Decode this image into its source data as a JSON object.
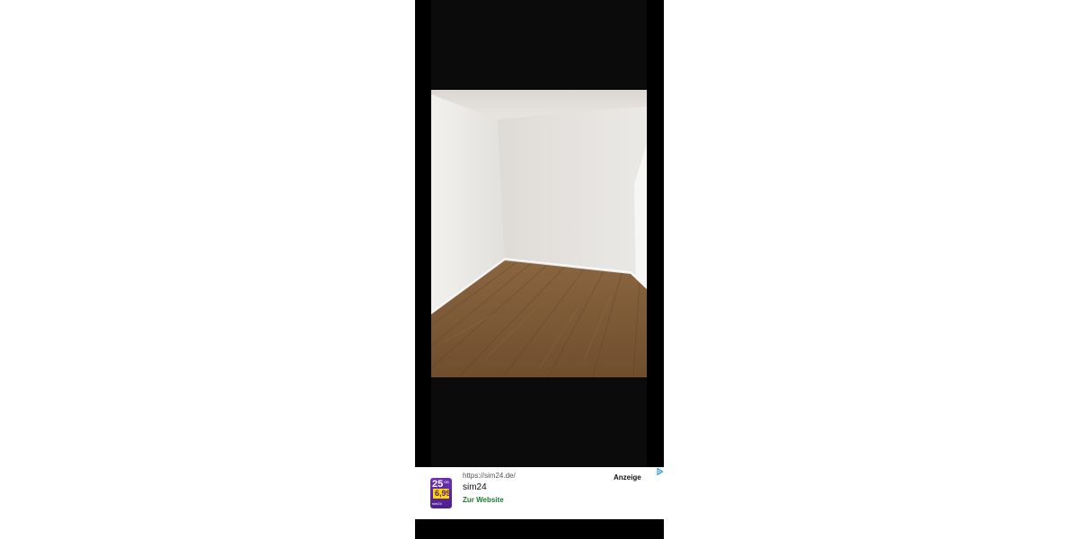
{
  "viewer": {
    "photo": {
      "subject": "empty-room-photo"
    }
  },
  "ad": {
    "url": "https://sim24.de/",
    "title": "sim24",
    "cta": "Zur Website",
    "label": "Anzeige",
    "logo": {
      "big_number": "25",
      "unit": "GB",
      "price": "6,99",
      "brand": "sim24"
    },
    "choices_icon": "ad-choices-icon"
  },
  "colors": {
    "background": "#ffffff",
    "viewer_bg": "#000000",
    "ad_cta": "#1f7a33",
    "logo_purple": "#6b2fb3",
    "logo_yellow": "#ffd800"
  }
}
